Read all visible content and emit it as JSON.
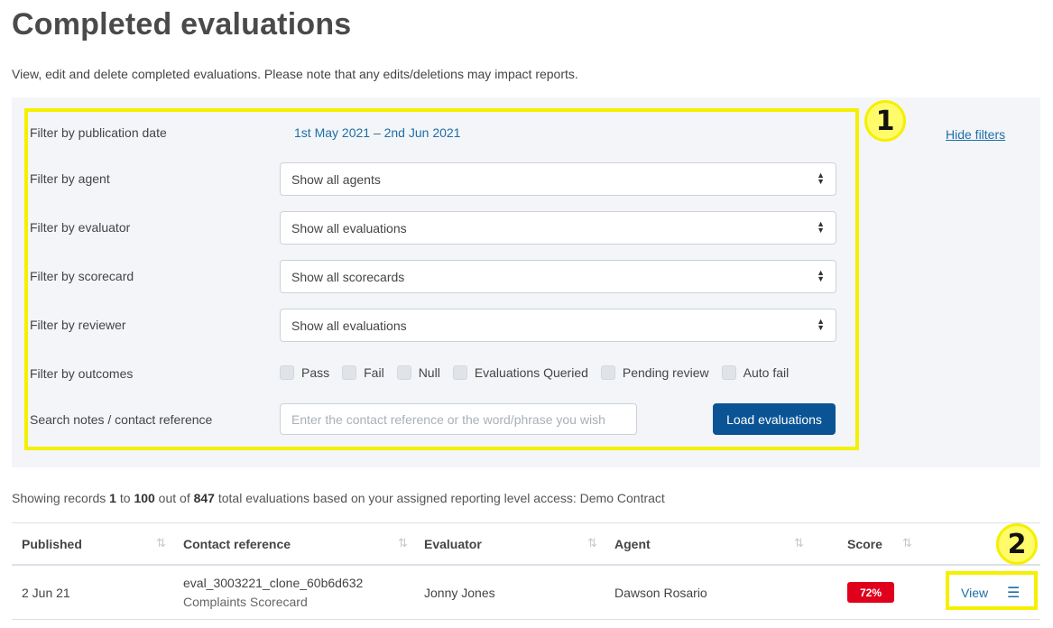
{
  "page": {
    "title": "Completed evaluations",
    "subtitle": "View, edit and delete completed evaluations. Please note that any edits/deletions may impact reports."
  },
  "filters": {
    "date_label": "Filter by publication date",
    "date_value": "1st May 2021 – 2nd Jun 2021",
    "hide_filters": "Hide filters",
    "agent_label": "Filter by agent",
    "agent_value": "Show all agents",
    "evaluator_label": "Filter by evaluator",
    "evaluator_value": "Show all evaluations",
    "scorecard_label": "Filter by scorecard",
    "scorecard_value": "Show all scorecards",
    "reviewer_label": "Filter by reviewer",
    "reviewer_value": "Show all evaluations",
    "outcomes_label": "Filter by outcomes",
    "outcomes": [
      "Pass",
      "Fail",
      "Null",
      "Evaluations Queried",
      "Pending review",
      "Auto fail"
    ],
    "search_label": "Search notes / contact reference",
    "search_placeholder": "Enter the contact reference or the word/phrase you wish",
    "load_button": "Load evaluations"
  },
  "annotations": {
    "badge1": "1",
    "badge2": "2"
  },
  "records": {
    "prefix": "Showing records ",
    "from": "1",
    "to_word": " to ",
    "to": "100",
    "outof_word": " out of ",
    "total": "847",
    "suffix": " total evaluations based on your assigned reporting level access: Demo Contract"
  },
  "table": {
    "headers": {
      "published": "Published",
      "contact": "Contact reference",
      "evaluator": "Evaluator",
      "agent": "Agent",
      "score": "Score"
    },
    "sort_icon": "⇅",
    "rows": [
      {
        "published": "2 Jun 21",
        "contact_ref": "eval_3003221_clone_60b6d632",
        "scorecard": "Complaints Scorecard",
        "evaluator": "Jonny Jones",
        "agent": "Dawson Rosario",
        "score": "72%",
        "view": "View"
      }
    ]
  },
  "colors": {
    "accent": "#0a5496",
    "link": "#1f6ea8",
    "highlight": "#f5ef00",
    "fail": "#e0001b"
  }
}
